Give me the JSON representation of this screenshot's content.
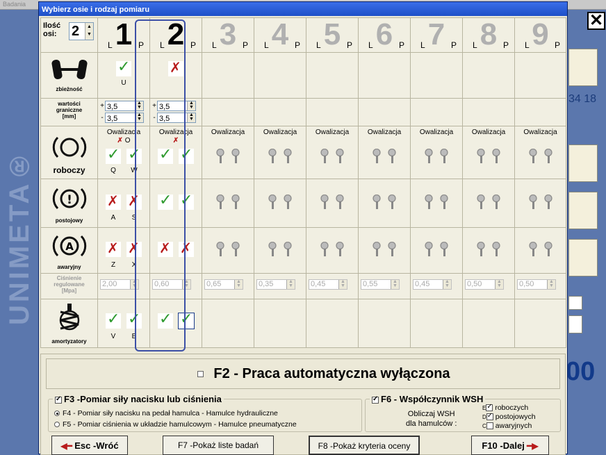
{
  "bg": {
    "window_title": "Badania",
    "logo": "UNIMETA®",
    "clock": "34 18",
    "big": "00"
  },
  "dialog": {
    "title": "Wybierz osie i rodzaj pomiaru"
  },
  "axle_count": {
    "label1": "Ilość",
    "label2": "osi:",
    "value": "2"
  },
  "axes": [
    {
      "n": "1",
      "L": "L",
      "P": "P"
    },
    {
      "n": "2",
      "L": "L",
      "P": "P"
    },
    {
      "n": "3",
      "L": "L",
      "P": "P"
    },
    {
      "n": "4",
      "L": "L",
      "P": "P"
    },
    {
      "n": "5",
      "L": "L",
      "P": "P"
    },
    {
      "n": "6",
      "L": "L",
      "P": "P"
    },
    {
      "n": "7",
      "L": "L",
      "P": "P"
    },
    {
      "n": "8",
      "L": "L",
      "P": "P"
    },
    {
      "n": "9",
      "L": "L",
      "P": "P"
    }
  ],
  "rows": {
    "zbieznosc": "zbieżność",
    "wartosci": [
      "wartości",
      "graniczne",
      "[mm]"
    ],
    "roboczy": "roboczy",
    "postojowy": "postojowy",
    "awaryjny": "awaryjny",
    "cisnienie": [
      "Ciśnienie",
      "regulowane",
      "[Mpa]"
    ],
    "amortyzatory": "amortyzatory"
  },
  "letters": {
    "u": "U",
    "o": "O",
    "q": "Q",
    "w": "W",
    "a": "A",
    "s": "S",
    "z": "Z",
    "x": "X",
    "v": "V",
    "b": "B"
  },
  "limits": {
    "plus": "+",
    "minus": "-",
    "a1_plus": "3,5",
    "a1_minus": "3,5",
    "a2_plus": "3,5",
    "a2_minus": "3,5"
  },
  "owalizacja": "Owalizacja",
  "pressure": [
    "2,00",
    "0,60",
    "0,65",
    "0,35",
    "0,45",
    "0,55",
    "0,45",
    "0,50",
    "0,50"
  ],
  "f2": "F2 - Praca automatyczna wyłączona",
  "f3": {
    "title": "F3 -Pomiar siły nacisku lub ciśnienia",
    "f4": "F4 - Pomiar siły nacisku na pedał hamulca  - Hamulce hydrauliczne",
    "f5": "F5 - Pomiar ciśnienia w układzie hamulcowym - Hamulce pneumatyczne"
  },
  "f6": {
    "title": "F6 - Współczynnik WSH",
    "l1": "Obliczaj WSH",
    "l2": "dla hamulców :",
    "o1": "roboczych",
    "o2": "postojowych",
    "o3": "awaryjnych",
    "k1": "E",
    "k2": "D",
    "k3": "C"
  },
  "buttons": {
    "esc": "Esc -Wróć",
    "f7": "F7 -Pokaż liste badań",
    "f8": "F8 -Pokaż kryteria oceny",
    "f10": "F10 -Dalej"
  }
}
